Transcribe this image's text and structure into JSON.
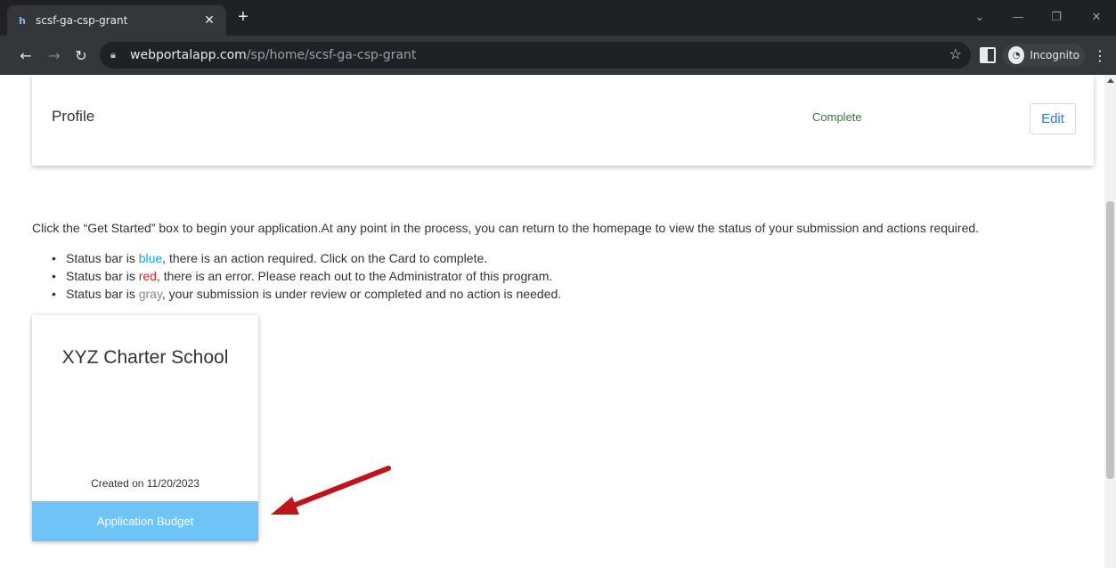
{
  "browser": {
    "tab_title": "scsf-ga-csp-grant",
    "url_host": "webportalapp.com",
    "url_path": "/sp/home/scsf-ga-csp-grant",
    "incognito_label": "Incognito"
  },
  "profile": {
    "label": "Profile",
    "status": "Complete",
    "edit_label": "Edit"
  },
  "instructions": {
    "intro": "Click the “Get Started” box to begin your application.At any point in the process, you can return to the homepage to view the status of your submission and actions required.",
    "bullets": [
      {
        "prefix": "Status bar is ",
        "color_word": "blue",
        "suffix": ", there is an action required. Click on the Card to complete."
      },
      {
        "prefix": "Status bar is ",
        "color_word": "red",
        "suffix": ", there is an error. Please reach out to the Administrator of this program."
      },
      {
        "prefix": "Status bar is ",
        "color_word": "gray",
        "suffix": ", your submission is under review or completed and no action is needed."
      }
    ]
  },
  "application_card": {
    "name": "XYZ Charter School",
    "created": "Created on 11/20/2023",
    "status_label": "Application Budget"
  },
  "colors": {
    "status_blue": "#6ec4f7",
    "annotation_arrow": "#c0141b",
    "complete_green": "#3c763d"
  }
}
